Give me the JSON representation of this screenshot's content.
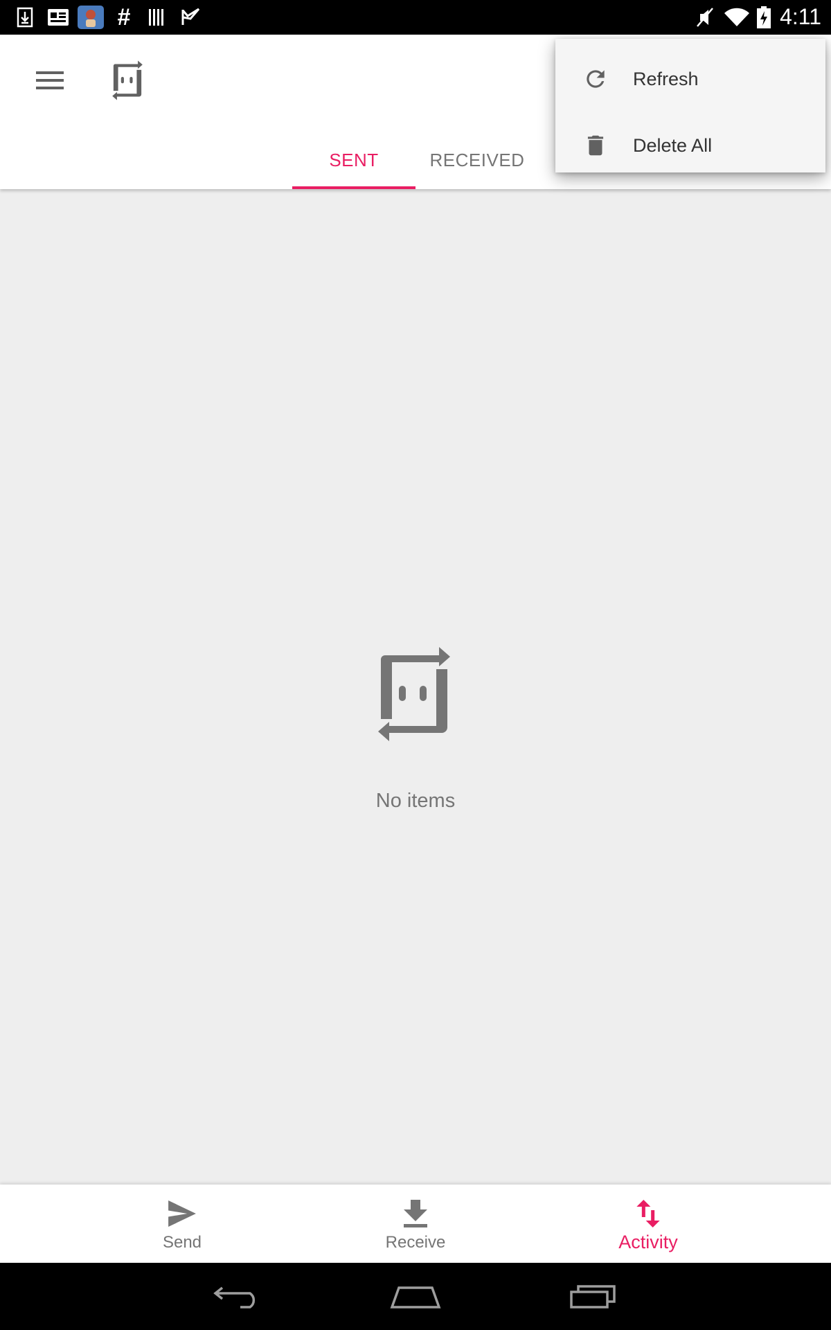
{
  "status_bar": {
    "time": "4:11",
    "left_icons": [
      "download-icon",
      "news-icon",
      "app-avatar-icon",
      "hashtag-icon",
      "barcode-icon",
      "check-flag-icon"
    ],
    "right_icons": [
      "mute-icon",
      "wifi-icon",
      "battery-icon"
    ]
  },
  "toolbar": {
    "menu_icon": "hamburger-icon",
    "logo_icon": "app-logo-icon"
  },
  "tabs": [
    {
      "label": "SENT",
      "selected": true
    },
    {
      "label": "RECEIVED",
      "selected": false
    }
  ],
  "overflow_menu": {
    "items": [
      {
        "label": "Refresh",
        "icon": "refresh-icon"
      },
      {
        "label": "Delete All",
        "icon": "trash-icon"
      }
    ]
  },
  "empty_state": {
    "text": "No items",
    "icon": "app-logo-icon"
  },
  "bottom_nav": {
    "items": [
      {
        "label": "Send",
        "icon": "send-icon",
        "active": false
      },
      {
        "label": "Receive",
        "icon": "download-icon",
        "active": false
      },
      {
        "label": "Activity",
        "icon": "swap-arrows-icon",
        "active": true
      }
    ]
  },
  "colors": {
    "accent": "#e91e63",
    "icon_gray": "#616161",
    "background": "#eeeeee"
  }
}
